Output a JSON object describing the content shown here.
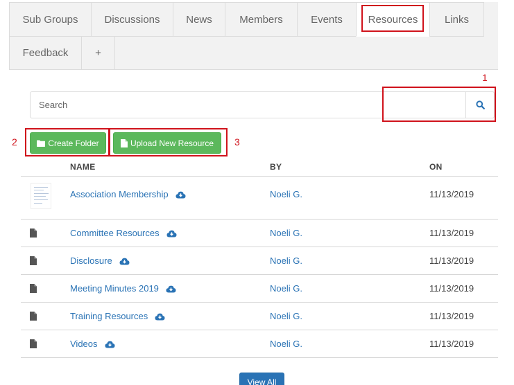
{
  "tabs": {
    "sub_groups": "Sub Groups",
    "discussions": "Discussions",
    "news": "News",
    "members": "Members",
    "events": "Events",
    "resources": "Resources",
    "links": "Links",
    "feedback": "Feedback",
    "add": "+"
  },
  "active_tab": "Resources",
  "annotations": {
    "one": "1",
    "two": "2",
    "three": "3",
    "color": "#d0121b"
  },
  "search": {
    "placeholder": "Search",
    "button_icon": "search-icon"
  },
  "actions": {
    "create_folder": "Create Folder",
    "create_folder_icon": "folder-icon",
    "upload": "Upload New Resource",
    "upload_icon": "file-icon",
    "button_color": "#5cb85c"
  },
  "table": {
    "headers": {
      "name": "NAME",
      "by": "BY",
      "on": "ON"
    },
    "rows": [
      {
        "name": "Association Membership",
        "by": "Noeli G.",
        "on": "11/13/2019",
        "icon": "document-thumbnail",
        "action_icon": "cloud-download-icon"
      },
      {
        "name": "Committee Resources",
        "by": "Noeli G.",
        "on": "11/13/2019",
        "icon": "file-icon",
        "action_icon": "cloud-download-icon"
      },
      {
        "name": "Disclosure",
        "by": "Noeli G.",
        "on": "11/13/2019",
        "icon": "file-icon",
        "action_icon": "cloud-download-icon"
      },
      {
        "name": "Meeting Minutes 2019",
        "by": "Noeli G.",
        "on": "11/13/2019",
        "icon": "file-icon",
        "action_icon": "cloud-download-icon"
      },
      {
        "name": "Training Resources",
        "by": "Noeli G.",
        "on": "11/13/2019",
        "icon": "file-icon",
        "action_icon": "cloud-download-icon"
      },
      {
        "name": "Videos",
        "by": "Noeli G.",
        "on": "11/13/2019",
        "icon": "file-icon",
        "action_icon": "cloud-download-icon"
      }
    ]
  },
  "view_all": "View All",
  "link_color": "#2a73b5"
}
